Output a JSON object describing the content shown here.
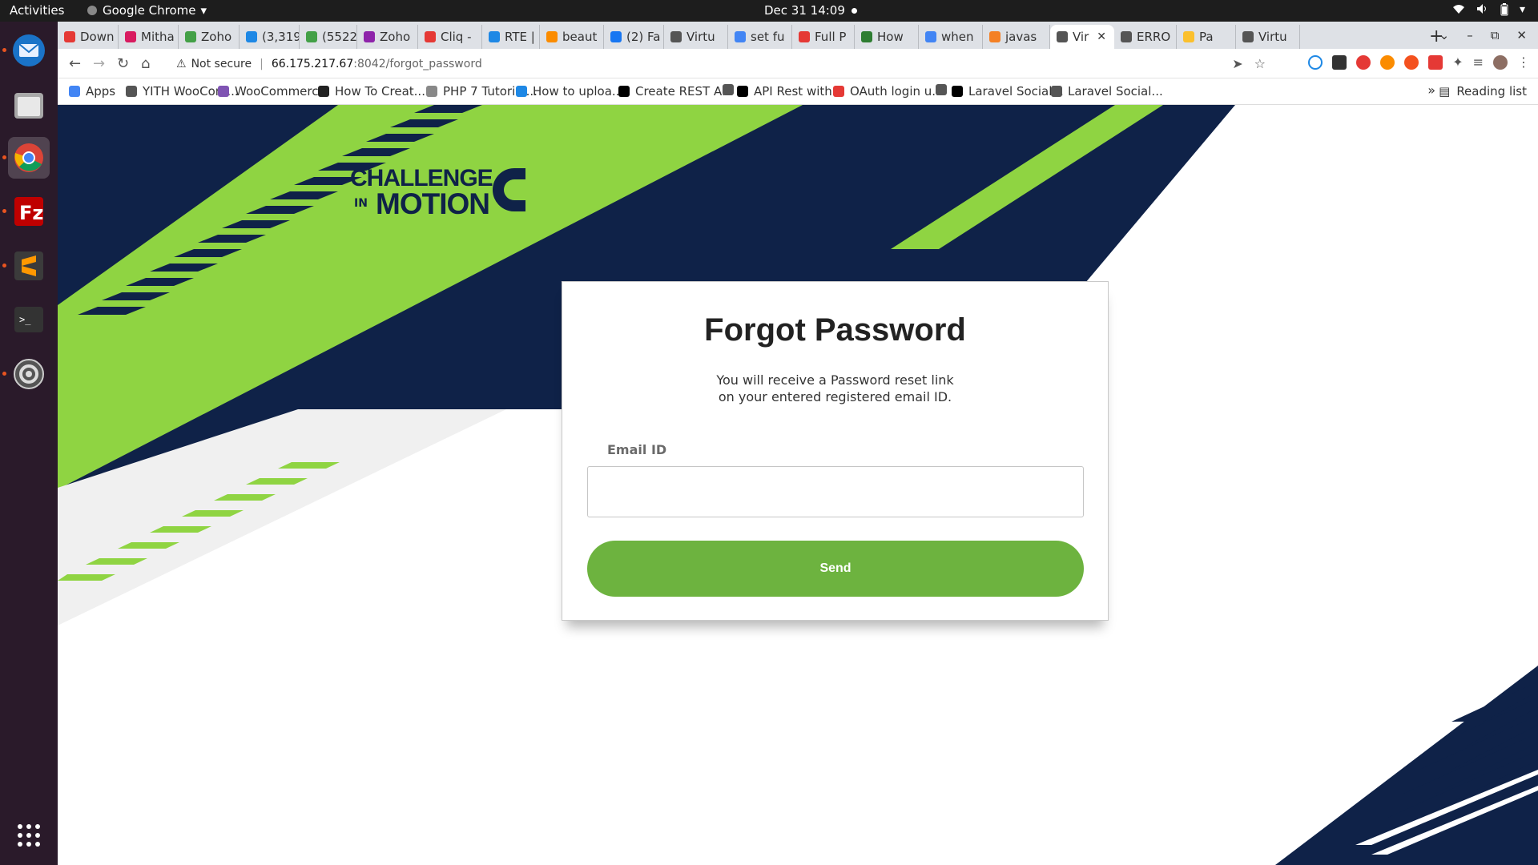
{
  "system_bar": {
    "activities": "Activities",
    "app_name": "Google Chrome",
    "datetime": "Dec 31  14:09"
  },
  "dock": {
    "apps": [
      "thunderbird-icon",
      "files-icon",
      "chrome-icon",
      "filezilla-icon",
      "sublime-text-icon",
      "terminal-icon",
      "settings-icon"
    ],
    "show_apps": "show-applications-icon"
  },
  "tabs": [
    {
      "label": "Down",
      "color": "#e53935"
    },
    {
      "label": "Mitha",
      "color": "#d81b60"
    },
    {
      "label": "Zoho",
      "color": "#43a047"
    },
    {
      "label": "(3,319",
      "color": "#1e88e5"
    },
    {
      "label": "(5522)",
      "color": "#43a047"
    },
    {
      "label": "Zoho",
      "color": "#8e24aa"
    },
    {
      "label": "Cliq -",
      "color": "#e53935"
    },
    {
      "label": "RTE |",
      "color": "#1e88e5"
    },
    {
      "label": "beaut",
      "color": "#fb8c00"
    },
    {
      "label": "(2) Fa",
      "color": "#1877f2"
    },
    {
      "label": "Virtu",
      "color": "#555555"
    },
    {
      "label": "set fu",
      "color": "#4285f4"
    },
    {
      "label": "Full P",
      "color": "#e53935"
    },
    {
      "label": "How",
      "color": "#2e7d32"
    },
    {
      "label": "when",
      "color": "#4285f4"
    },
    {
      "label": "javas",
      "color": "#f48024"
    },
    {
      "label": "Vir",
      "color": "#555555",
      "active": true
    },
    {
      "label": "ERRO",
      "color": "#555555"
    },
    {
      "label": "Pa",
      "color": "#fbc02d"
    },
    {
      "label": "Virtu",
      "color": "#555555"
    }
  ],
  "toolbar": {
    "security_label": "Not secure",
    "url_host": "66.175.217.67",
    "url_path": ":8042/forgot_password"
  },
  "bookmarks": [
    {
      "label": "Apps",
      "color": "#4285f4"
    },
    {
      "label": "YITH WooCom...",
      "color": "#555555"
    },
    {
      "label": "WooCommerc...",
      "color": "#7f54b3"
    },
    {
      "label": "How To Creat...",
      "color": "#222222"
    },
    {
      "label": "PHP 7 Tutorial...",
      "color": "#888888"
    },
    {
      "label": "How to uploa...",
      "color": "#1e88e5"
    },
    {
      "label": "Create REST A...",
      "color": "#000000"
    },
    {
      "label": "",
      "color": "#555555"
    },
    {
      "label": "API Rest with...",
      "color": "#000000"
    },
    {
      "label": "OAuth login u...",
      "color": "#e53935"
    },
    {
      "label": "",
      "color": "#555555"
    },
    {
      "label": "Laravel Social...",
      "color": "#000000"
    },
    {
      "label": "Laravel Social...",
      "color": "#555555"
    }
  ],
  "bookmarks_more": "»",
  "reading_list": "Reading list",
  "logo": {
    "line1": "CHALLENGE",
    "in": "IN",
    "line2": "MOTION"
  },
  "form": {
    "title": "Forgot Password",
    "desc_line1": "You will receive a Password reset link",
    "desc_line2": "on your entered registered email ID.",
    "email_label": "Email ID",
    "email_value": "",
    "email_placeholder": "",
    "send_label": "Send"
  },
  "colors": {
    "navy": "#0f2248",
    "green": "#8fd442",
    "button_green": "#6db33f"
  }
}
